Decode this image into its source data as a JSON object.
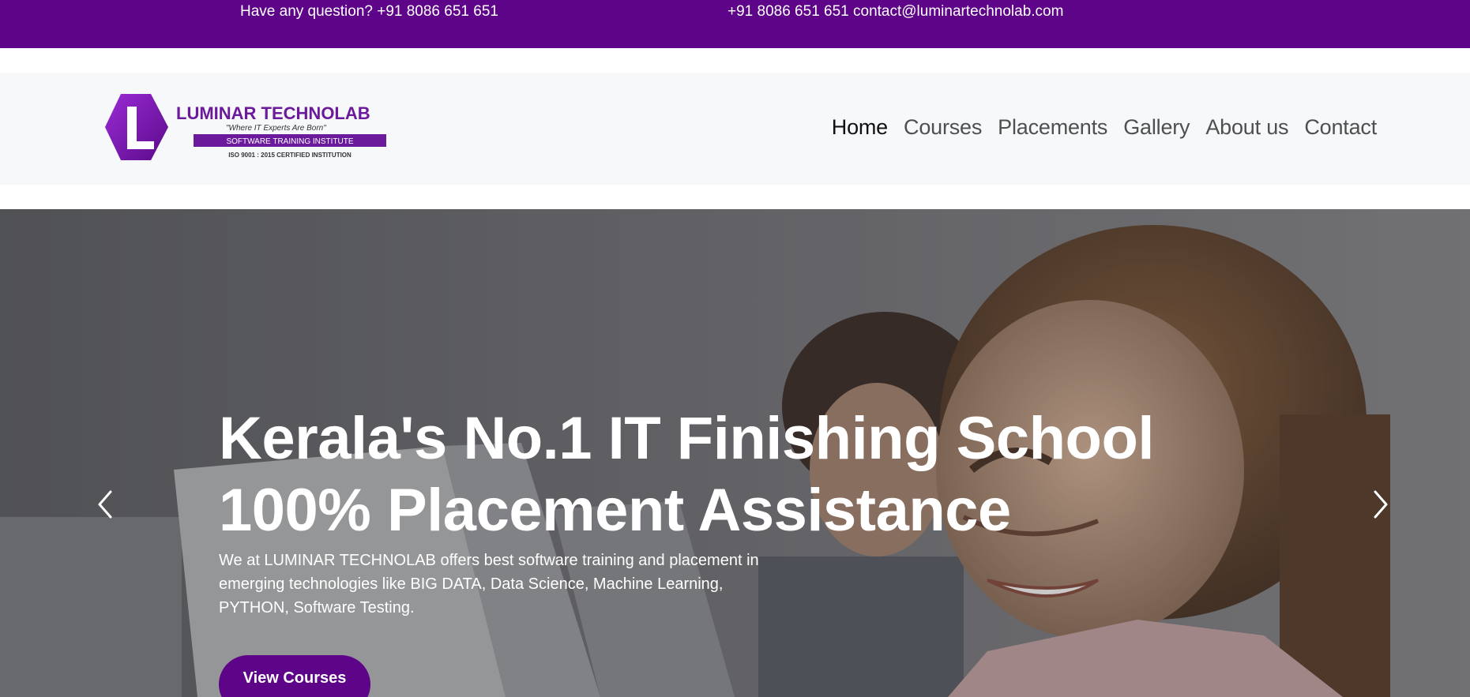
{
  "topbar": {
    "question_text": "Have any question? +91 8086 651 651",
    "contact_text": "+91 8086 651 651 contact@luminartechnolab.com"
  },
  "logo": {
    "name": "LUMINAR TECHNOLAB",
    "tagline": "\"Where IT Experts Are Born\"",
    "band": "SOFTWARE TRAINING INSTITUTE",
    "cert": "ISO 9001 : 2015 CERTIFIED INSTITUTION"
  },
  "nav": {
    "items": [
      {
        "label": "Home",
        "active": true
      },
      {
        "label": "Courses"
      },
      {
        "label": "Placements"
      },
      {
        "label": "Gallery"
      },
      {
        "label": "About us"
      },
      {
        "label": "Contact"
      }
    ]
  },
  "hero": {
    "headline_line1": "Kerala's No.1 IT Finishing School",
    "headline_line2": "100% Placement Assistance",
    "description": "We at LUMINAR TECHNOLAB offers best software training and placement in emerging technologies like BIG DATA, Data Science, Machine Learning, PYTHON, Software Testing.",
    "cta_label": "View Courses",
    "prev_icon": "chevron-left-icon",
    "next_icon": "chevron-right-icon"
  },
  "colors": {
    "brand_purple": "#5e0489",
    "nav_background": "#f7f8fa"
  }
}
